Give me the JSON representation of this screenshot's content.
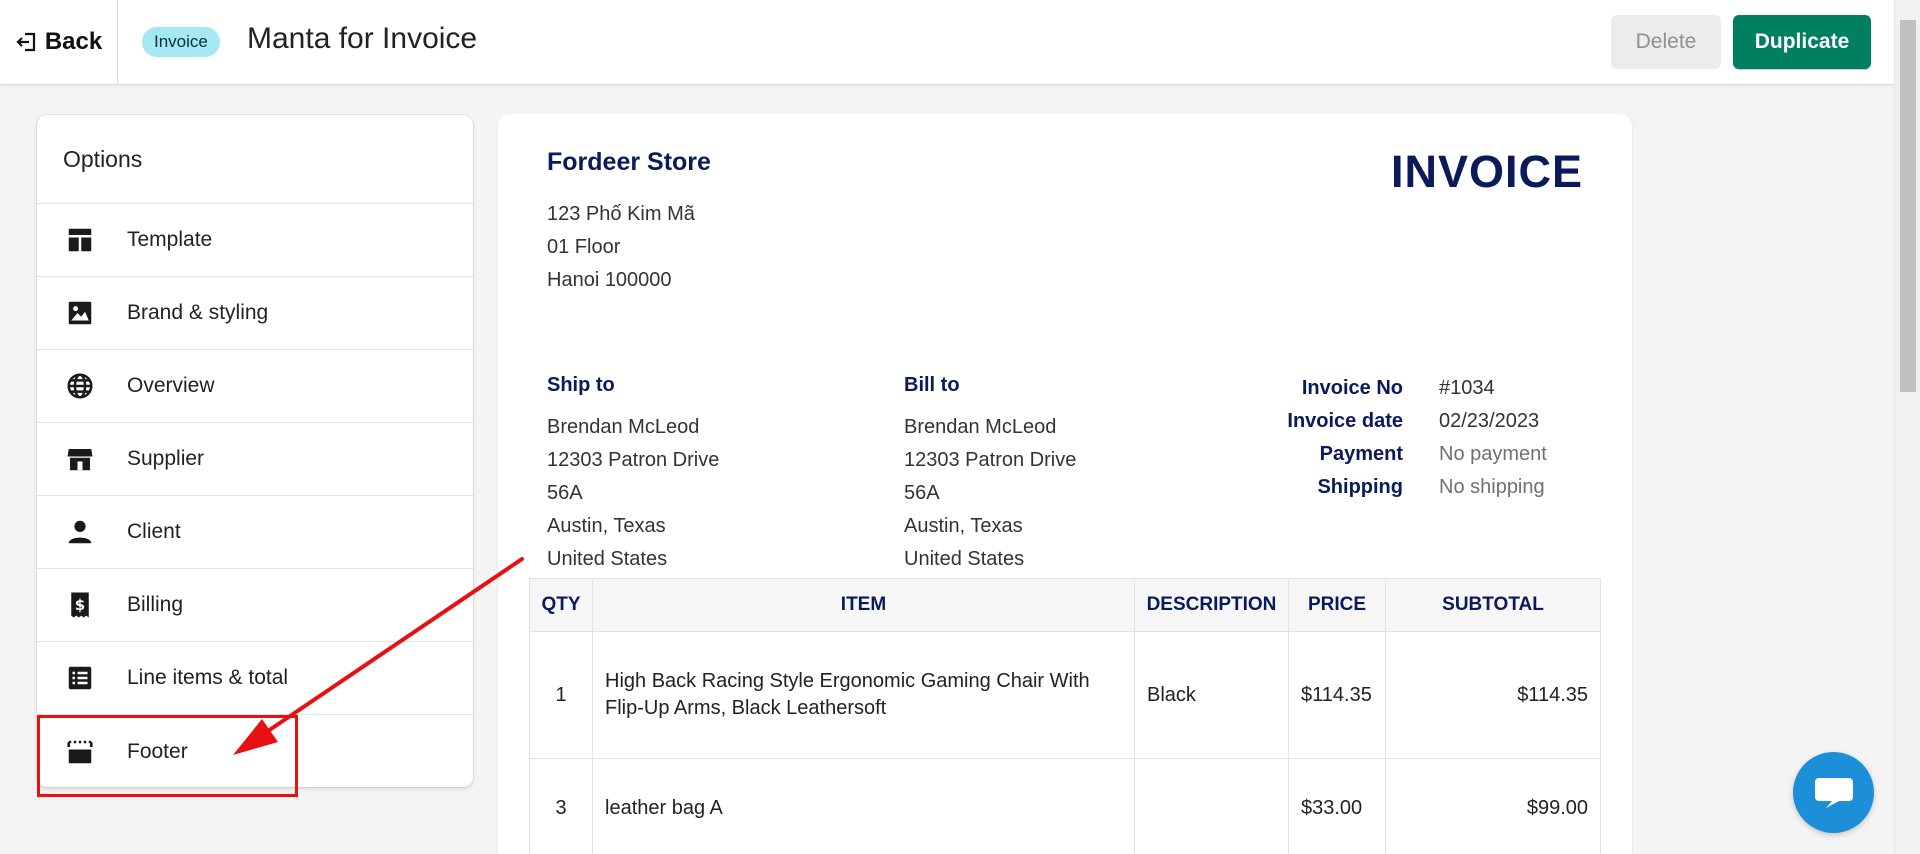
{
  "header": {
    "back_label": "Back",
    "badge": "Invoice",
    "title": "Manta for Invoice",
    "delete_label": "Delete",
    "duplicate_label": "Duplicate"
  },
  "options": {
    "title": "Options",
    "items": [
      {
        "label": "Template",
        "icon": "template-icon"
      },
      {
        "label": "Brand & styling",
        "icon": "image-icon"
      },
      {
        "label": "Overview",
        "icon": "globe-icon"
      },
      {
        "label": "Supplier",
        "icon": "store-icon"
      },
      {
        "label": "Client",
        "icon": "person-icon"
      },
      {
        "label": "Billing",
        "icon": "receipt-icon"
      },
      {
        "label": "Line items & total",
        "icon": "list-icon"
      },
      {
        "label": "Footer",
        "icon": "footer-icon"
      }
    ]
  },
  "invoice": {
    "store_name": "Fordeer Store",
    "heading": "INVOICE",
    "store_address": [
      "123 Phố Kim Mã",
      "01 Floor",
      "Hanoi 100000"
    ],
    "ship_to": {
      "heading": "Ship to",
      "lines": [
        "Brendan McLeod",
        "12303 Patron Drive",
        "56A",
        "Austin, Texas",
        "United States"
      ]
    },
    "bill_to": {
      "heading": "Bill to",
      "lines": [
        "Brendan McLeod",
        "12303 Patron Drive",
        "56A",
        "Austin, Texas",
        "United States"
      ]
    },
    "meta": [
      {
        "label": "Invoice No",
        "value": "#1034"
      },
      {
        "label": "Invoice date",
        "value": "02/23/2023"
      },
      {
        "label": "Payment",
        "value": "No payment"
      },
      {
        "label": "Shipping",
        "value": "No shipping"
      }
    ],
    "table": {
      "headers": [
        "QTY",
        "ITEM",
        "DESCRIPTION",
        "PRICE",
        "SUBTOTAL"
      ],
      "rows": [
        {
          "qty": "1",
          "item": "High Back Racing Style Ergonomic Gaming Chair With Flip-Up Arms, Black Leathersoft",
          "description": "Black",
          "price": "$114.35",
          "subtotal": "$114.35"
        },
        {
          "qty": "3",
          "item": "leather bag A",
          "description": "",
          "price": "$33.00",
          "subtotal": "$99.00"
        }
      ]
    }
  },
  "colors": {
    "primary": "#008060",
    "navy": "#0b1a5a",
    "badge_bg": "#a4e8f2",
    "annotation": "#e81010",
    "chat": "#1d8fd8"
  }
}
